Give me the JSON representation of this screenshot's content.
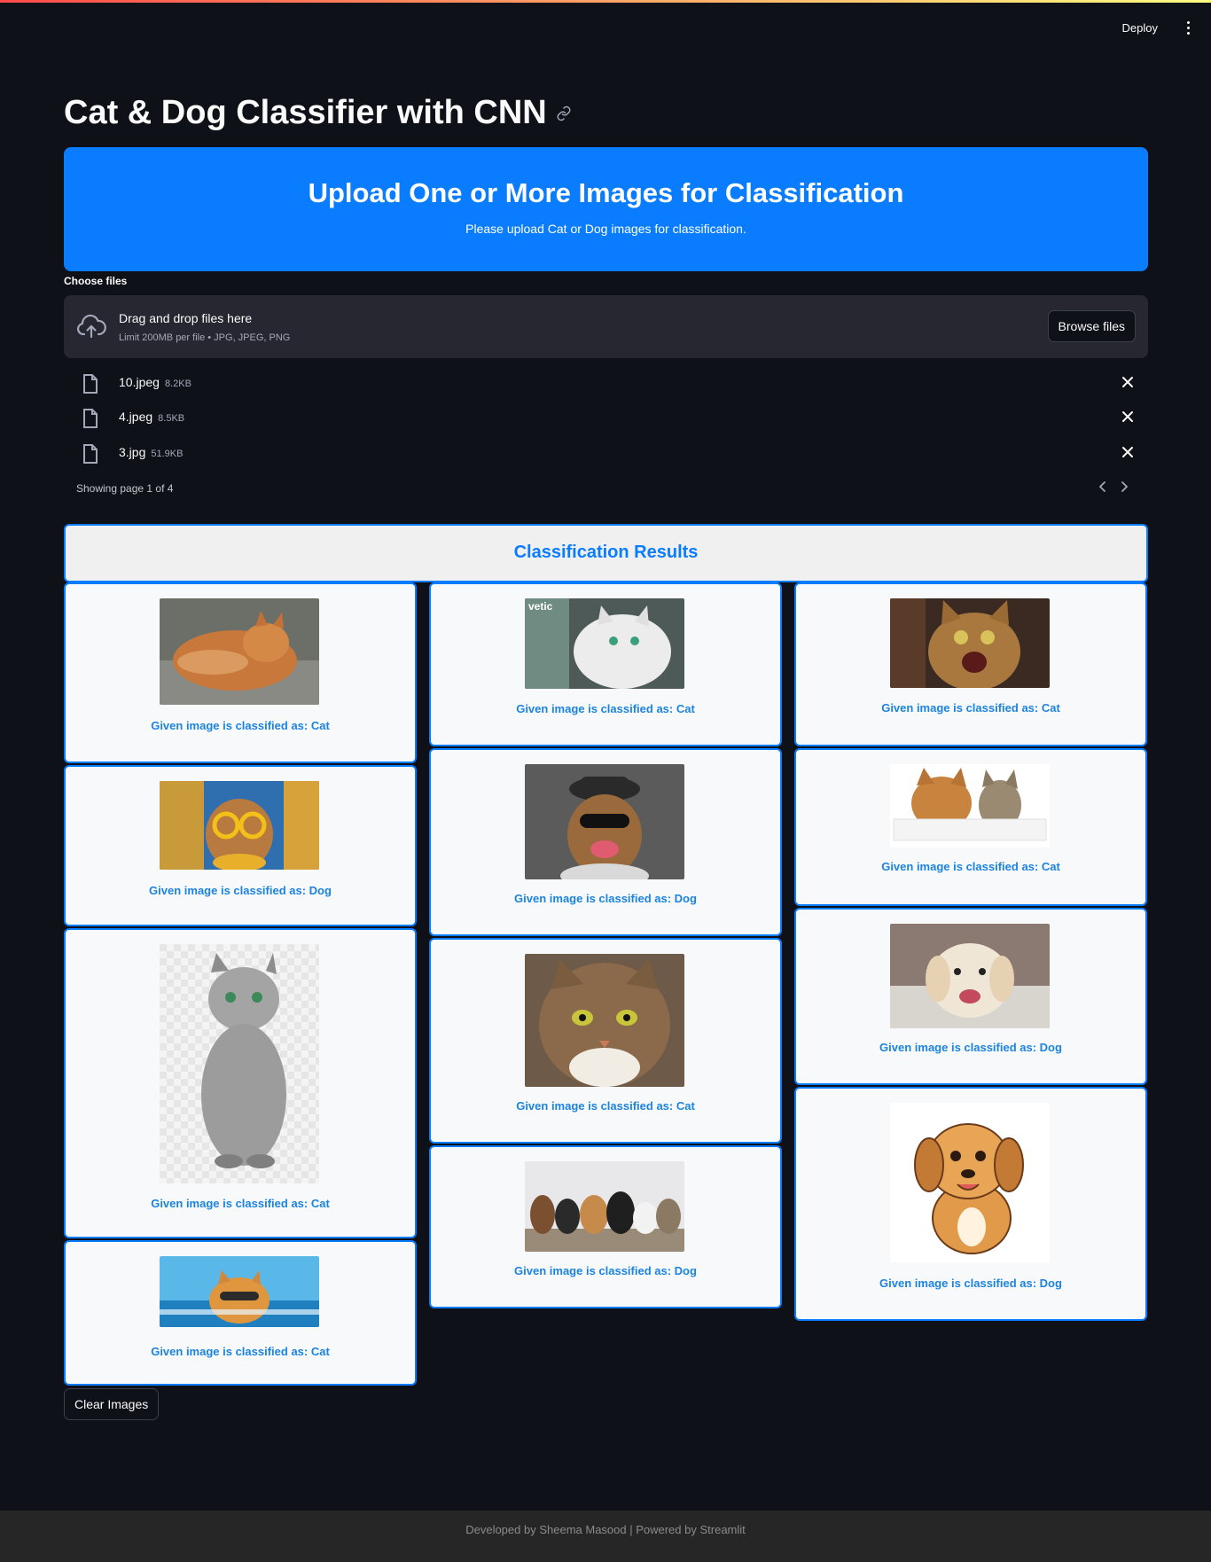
{
  "header": {
    "deploy_label": "Deploy",
    "menu_icon": "kebab-icon"
  },
  "page": {
    "title": "Cat & Dog Classifier with CNN"
  },
  "banner": {
    "title": "Upload One or More Images for Classification",
    "subtitle": "Please upload Cat or Dog images for classification.",
    "color": "#0a7cff"
  },
  "uploader": {
    "label": "Choose files",
    "drop_title": "Drag and drop files here",
    "drop_limit": "Limit 200MB per file • JPG, JPEG, PNG",
    "browse_label": "Browse files",
    "files": [
      {
        "name": "10.jpeg",
        "size": "8.2KB"
      },
      {
        "name": "4.jpeg",
        "size": "8.5KB"
      },
      {
        "name": "3.jpg",
        "size": "51.9KB"
      }
    ],
    "pagination": "Showing page 1 of 4"
  },
  "results": {
    "header": "Classification Results",
    "cards": [
      {
        "caption": "Given image is classified as: Cat",
        "image": "orange cat lying on side"
      },
      {
        "caption": "Given image is classified as: Cat",
        "image": "white fluffy cat by window",
        "watermark": "vetic"
      },
      {
        "caption": "Given image is classified as: Cat",
        "image": "surprised tabby cat"
      },
      {
        "caption": "Given image is classified as: Dog",
        "image": "dog with yellow sunglasses"
      },
      {
        "caption": "Given image is classified as: Dog",
        "image": "dog with hat and sunglasses"
      },
      {
        "caption": "Given image is classified as: Cat",
        "image": "dog and cat peeking over board"
      },
      {
        "caption": "Given image is classified as: Cat",
        "image": "silver tabby cat sitting"
      },
      {
        "caption": "Given image is classified as: Cat",
        "image": "tabby cat face close-up"
      },
      {
        "caption": "Given image is classified as: Dog",
        "image": "golden retriever outdoors"
      },
      {
        "caption": "Given image is classified as: Cat",
        "image": "cat with sunglasses in water"
      },
      {
        "caption": "Given image is classified as: Dog",
        "image": "row of dogs and cats"
      },
      {
        "caption": "Given image is classified as: Dog",
        "image": "cartoon puppy"
      }
    ],
    "accent": "#0a7cff",
    "caption_color": "#1c83e1"
  },
  "clear_label": "Clear Images",
  "footer": {
    "text": "Developed by Sheema Masood | Powered by Streamlit"
  }
}
